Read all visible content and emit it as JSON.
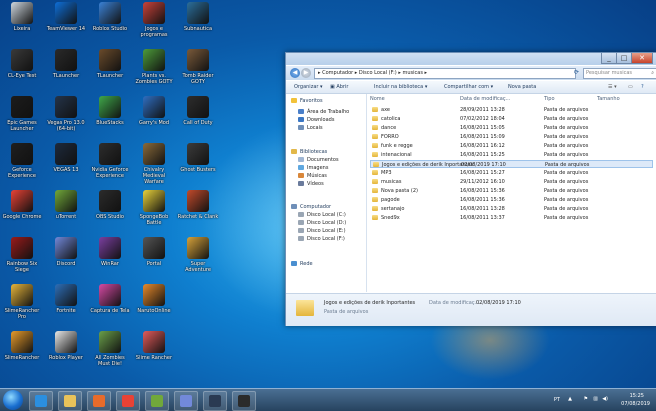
{
  "desktop": {
    "icons": [
      {
        "label": "Lixeira",
        "icon": "recycle-bin-icon",
        "color": "#cfd8e0"
      },
      {
        "label": "CL-Eye Test",
        "icon": "camera-icon",
        "color": "#3a3a3a"
      },
      {
        "label": "Epic Games Launcher",
        "icon": "epic-games-icon",
        "color": "#1c1c1c"
      },
      {
        "label": "Geforce Experience",
        "icon": "nvidia-icon",
        "color": "#1f1f1f"
      },
      {
        "label": "Google Chrome",
        "icon": "chrome-icon",
        "color": "#e94235"
      },
      {
        "label": "Rainbow Six Siege",
        "icon": "game-icon",
        "color": "#9b1b1b"
      },
      {
        "label": "SlimeRancher Pro",
        "icon": "slime-icon",
        "color": "#e7b53a"
      },
      {
        "label": "SlimeRancher",
        "icon": "slime-icon",
        "color": "#e89b2b"
      },
      {
        "label": "TeamViewer 14",
        "icon": "teamviewer-icon",
        "color": "#0e6fd8"
      },
      {
        "label": "TLauncher",
        "icon": "tlauncher-icon",
        "color": "#2a2a2a"
      },
      {
        "label": "Vegas Pro 13.0 (64-bit)",
        "icon": "vegas-icon",
        "color": "#24344a"
      },
      {
        "label": "VEGAS 13",
        "icon": "vegas-icon",
        "color": "#1d2a3d"
      },
      {
        "label": "uTorrent",
        "icon": "utorrent-icon",
        "color": "#71a83a"
      },
      {
        "label": "Discord",
        "icon": "discord-icon",
        "color": "#7289da"
      },
      {
        "label": "Fortnite",
        "icon": "fortnite-icon",
        "color": "#2e6fb8"
      },
      {
        "label": "Roblox Player",
        "icon": "roblox-icon",
        "color": "#e8e8e8"
      },
      {
        "label": "Roblox Studio",
        "icon": "roblox-studio-icon",
        "color": "#3b82d6"
      },
      {
        "label": "TLauncher",
        "icon": "minecraft-icon",
        "color": "#6b4b2b"
      },
      {
        "label": "BlueStacks",
        "icon": "bluestacks-icon",
        "color": "#3fa84a"
      },
      {
        "label": "Nvidia Geforce Experience",
        "icon": "nvidia-icon",
        "color": "#2d2d2d"
      },
      {
        "label": "OBS Studio",
        "icon": "obs-icon",
        "color": "#2b2b2b"
      },
      {
        "label": "WinRar",
        "icon": "winrar-icon",
        "color": "#7b3fa0"
      },
      {
        "label": "Captura de Tela",
        "icon": "capture-icon",
        "color": "#d64aa4"
      },
      {
        "label": "All Zombies Must Die!",
        "icon": "zombie-icon",
        "color": "#6aa04a"
      },
      {
        "label": "Jogos e programas",
        "icon": "folder-games-icon",
        "color": "#c9423a"
      },
      {
        "label": "Plants vs. Zombies GOTY",
        "icon": "pvz-icon",
        "color": "#4d9c3a"
      },
      {
        "label": "Garry's Mod",
        "icon": "gmod-icon",
        "color": "#2f6fc2"
      },
      {
        "label": "Chivalry Medieval Warfare",
        "icon": "chivalry-icon",
        "color": "#8a6a3a"
      },
      {
        "label": "SpongeBob Battle",
        "icon": "spongebob-icon",
        "color": "#e8d23a"
      },
      {
        "label": "Portal",
        "icon": "portal-icon",
        "color": "#555555"
      },
      {
        "label": "NarutoOnline",
        "icon": "naruto-icon",
        "color": "#e88a2b"
      },
      {
        "label": "Slime Rancher",
        "icon": "slime-icon",
        "color": "#e35b5b"
      },
      {
        "label": "Subnautica",
        "icon": "subnautica-icon",
        "color": "#2b6f9c"
      },
      {
        "label": "Tomb Raider GOTY",
        "icon": "tomb-raider-icon",
        "color": "#7a5a3a"
      },
      {
        "label": "Call of Duty",
        "icon": "cod-icon",
        "color": "#2d2d2d"
      },
      {
        "label": "Ghost Busters",
        "icon": "ghost-icon",
        "color": "#3c3c3c"
      },
      {
        "label": "Ratchet & Clank",
        "icon": "game-icon",
        "color": "#c24a2b"
      },
      {
        "label": "Super Adventure",
        "icon": "game-icon",
        "color": "#d6a23a"
      }
    ]
  },
  "explorer": {
    "breadcrumb": [
      "Computador",
      "Disco Local (F:)",
      "musicas"
    ],
    "search_placeholder": "Pesquisar musicas",
    "toolbar": {
      "organize": "Organizar ▾",
      "open": "Abrir",
      "include": "Incluir na biblioteca ▾",
      "share": "Compartilhar com ▾",
      "new_folder": "Nova pasta"
    },
    "nav": {
      "favorites": "Favoritos",
      "favorites_items": [
        "Área de Trabalho",
        "Downloads",
        "Locais"
      ],
      "libraries": "Bibliotecas",
      "libraries_items": [
        "Documentos",
        "Imagens",
        "Músicas",
        "Vídeos"
      ],
      "computer": "Computador",
      "computer_items": [
        "Disco Local (C:)",
        "Disco Local (D:)",
        "Disco Local (E:)",
        "Disco Local (F:)"
      ],
      "network": "Rede"
    },
    "columns": {
      "name": "Nome",
      "date": "Data de modificaç...",
      "type": "Tipo",
      "size": "Tamanho"
    },
    "files": [
      {
        "name": "axe",
        "date": "28/09/2011 13:28",
        "type": "Pasta de arquivos"
      },
      {
        "name": "catolica",
        "date": "07/02/2012 18:04",
        "type": "Pasta de arquivos"
      },
      {
        "name": "dance",
        "date": "16/08/2011 15:05",
        "type": "Pasta de arquivos"
      },
      {
        "name": "FORRO",
        "date": "16/08/2011 15:09",
        "type": "Pasta de arquivos"
      },
      {
        "name": "funk e regge",
        "date": "16/08/2011 16:12",
        "type": "Pasta de arquivos"
      },
      {
        "name": "intenacional",
        "date": "16/08/2011 15:25",
        "type": "Pasta de arquivos"
      },
      {
        "name": "Jogos e edições de derik Inportantes",
        "date": "02/08/2019 17:10",
        "type": "Pasta de arquivos"
      },
      {
        "name": "MP3",
        "date": "16/08/2011 15:27",
        "type": "Pasta de arquivos"
      },
      {
        "name": "musicas",
        "date": "29/11/2012 16:10",
        "type": "Pasta de arquivos"
      },
      {
        "name": "Nova pasta (2)",
        "date": "16/08/2011 15:36",
        "type": "Pasta de arquivos"
      },
      {
        "name": "pagode",
        "date": "16/08/2011 15:36",
        "type": "Pasta de arquivos"
      },
      {
        "name": "sertanajo",
        "date": "16/08/2011 13:28",
        "type": "Pasta de arquivos"
      },
      {
        "name": "Sned9x",
        "date": "16/08/2011 13:37",
        "type": "Pasta de arquivos"
      }
    ],
    "selected_index": 6,
    "details": {
      "name": "Jogos e edições de derik Inportantes",
      "date_label": "Data de modificaç...",
      "date": "02/08/2019 17:10",
      "type": "Pasta de arquivos"
    }
  },
  "taskbar": {
    "apps": [
      {
        "icon": "ie-icon",
        "color": "#2b8fe0"
      },
      {
        "icon": "explorer-icon",
        "color": "#e8c25a"
      },
      {
        "icon": "media-player-icon",
        "color": "#e86b2b"
      },
      {
        "icon": "chrome-icon",
        "color": "#e94235"
      },
      {
        "icon": "utorrent-icon",
        "color": "#71a83a"
      },
      {
        "icon": "discord-icon",
        "color": "#7289da"
      },
      {
        "icon": "vegas-icon",
        "color": "#2a3a52"
      },
      {
        "icon": "obs-icon",
        "color": "#2b2b2b"
      }
    ],
    "lang": "PT",
    "time": "15:25",
    "date": "07/08/2019"
  }
}
